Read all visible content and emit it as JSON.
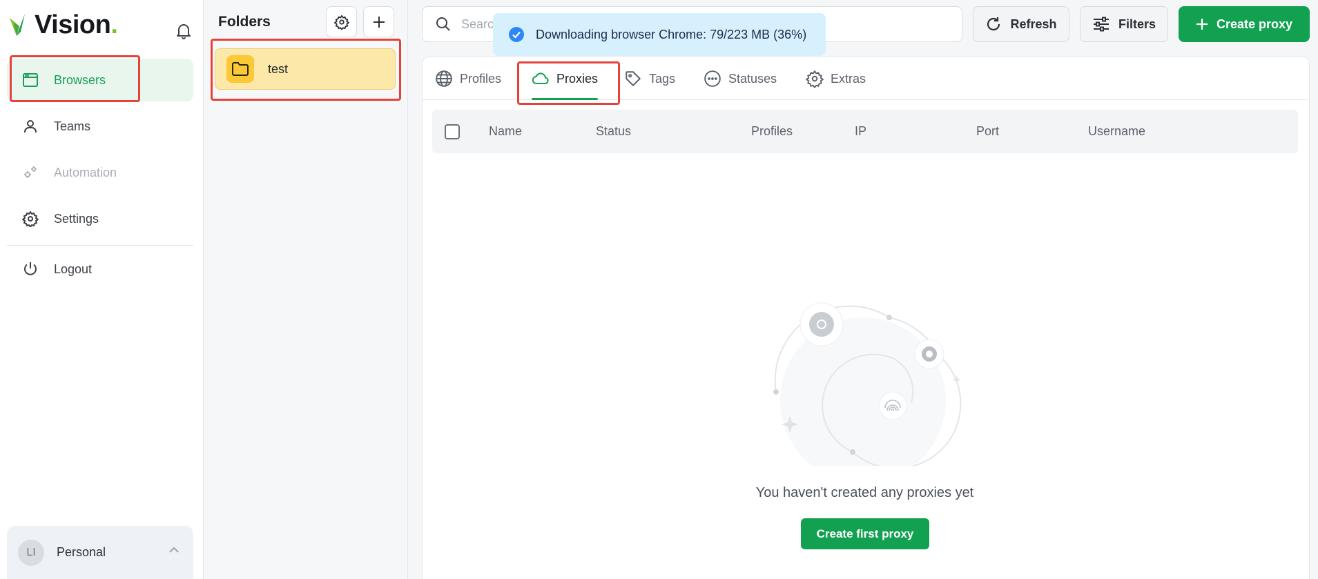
{
  "app": {
    "logo_text": "Vision",
    "logo_dot": "."
  },
  "sidebar": {
    "items": [
      {
        "label": "Browsers",
        "icon": "browser-window-icon",
        "active": true
      },
      {
        "label": "Teams",
        "icon": "person-icon"
      },
      {
        "label": "Automation",
        "icon": "gears-icon",
        "disabled": true
      },
      {
        "label": "Settings",
        "icon": "gear-icon"
      },
      {
        "label": "Logout",
        "icon": "power-icon"
      }
    ],
    "account": {
      "initials": "LI",
      "name": "Personal"
    }
  },
  "folders": {
    "title": "Folders",
    "items": [
      {
        "name": "test"
      }
    ]
  },
  "search": {
    "placeholder": "Search"
  },
  "toolbar": {
    "refresh_label": "Refresh",
    "filters_label": "Filters",
    "create_label": "Create proxy"
  },
  "toast": {
    "text": "Downloading browser Chrome: 79/223 MB (36%)",
    "downloaded_mb": 79,
    "total_mb": 223,
    "percent": 36
  },
  "tabs": [
    {
      "label": "Profiles",
      "icon": "globe-icon"
    },
    {
      "label": "Proxies",
      "icon": "cloud-icon",
      "active": true
    },
    {
      "label": "Tags",
      "icon": "tag-icon"
    },
    {
      "label": "Statuses",
      "icon": "dots-circle-icon"
    },
    {
      "label": "Extras",
      "icon": "gear-icon"
    }
  ],
  "table": {
    "columns": [
      "Name",
      "Status",
      "Profiles",
      "IP",
      "Port",
      "Username"
    ]
  },
  "empty": {
    "message": "You haven't created any proxies yet",
    "button_label": "Create first proxy"
  },
  "colors": {
    "accent": "#12a150",
    "highlight": "#e5433a",
    "folder": "#fbc936",
    "toast_bg": "#d6f1fd"
  }
}
